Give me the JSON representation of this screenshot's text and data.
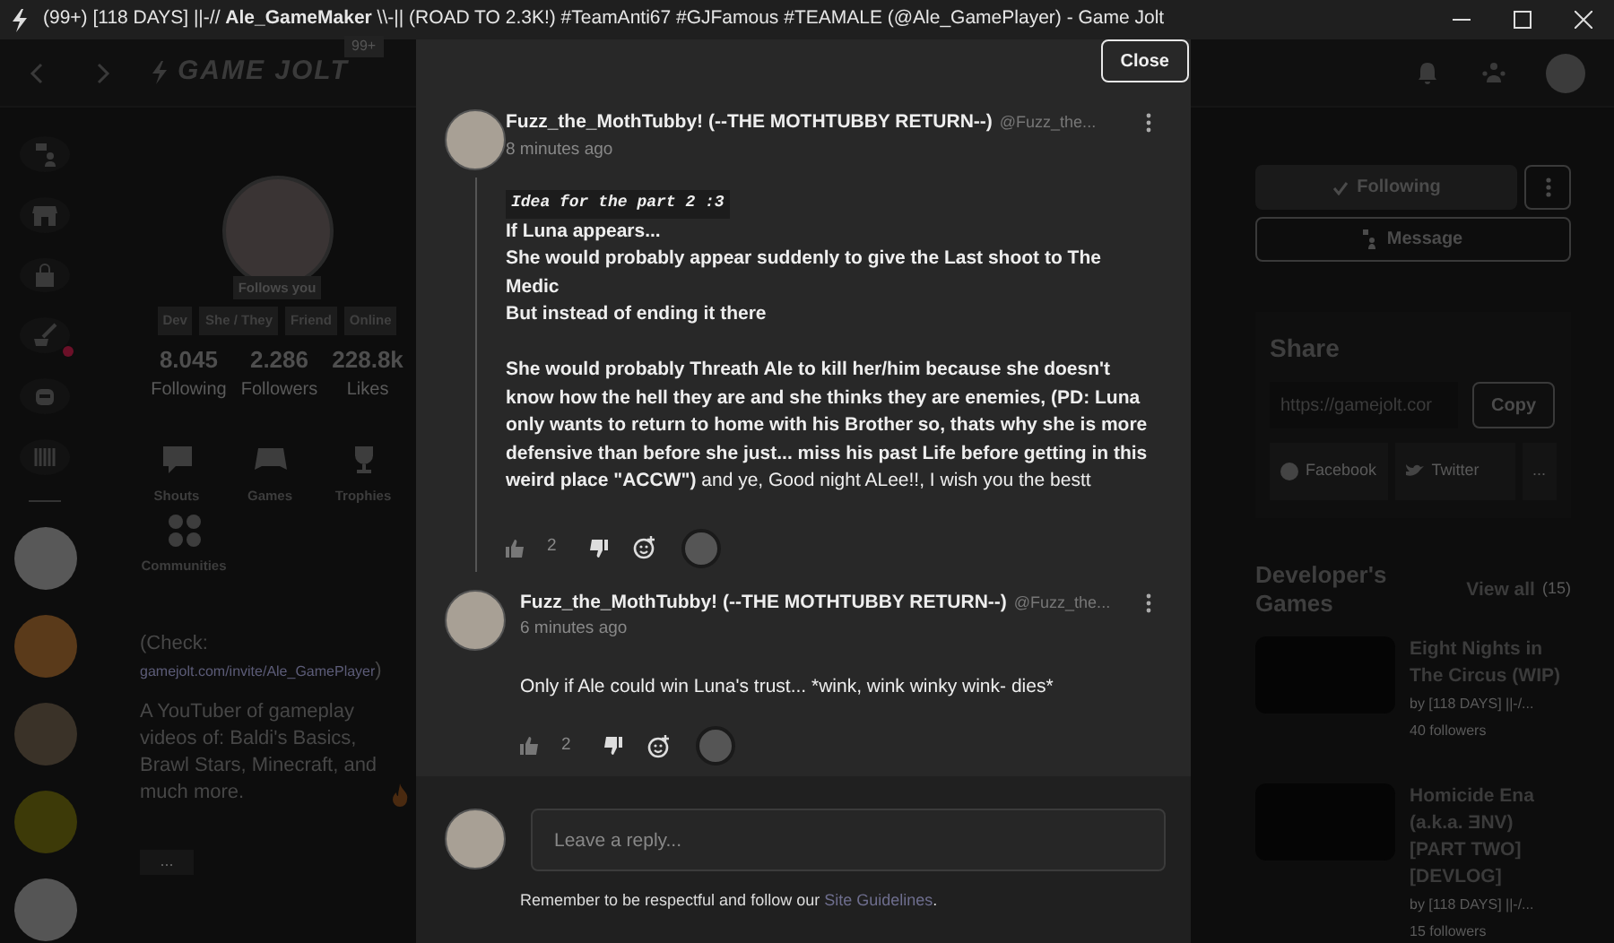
{
  "window": {
    "title": "(99+) [118 DAYS] ||-// **Ale_GameMaker** \\\\-|| (ROAD TO 2.3K!) #TeamAnti67 #GJFamous #TEAMALE (@Ale_GamePlayer) - Game Jolt"
  },
  "topbar": {
    "logo": "GAME JOLT",
    "badge": "99+"
  },
  "rail": {
    "items": [
      {
        "kind": "chat",
        "notification": false
      },
      {
        "kind": "store",
        "notification": false
      },
      {
        "kind": "bag",
        "notification": false
      },
      {
        "kind": "quill",
        "notification": true
      },
      {
        "kind": "bot",
        "notification": false
      },
      {
        "kind": "library",
        "notification": false
      }
    ]
  },
  "profile": {
    "follows_badge": "Follows you",
    "tags": [
      "Dev",
      "She / They",
      "Friend",
      "Online"
    ],
    "stats": [
      {
        "value": "8.045",
        "label": "Following"
      },
      {
        "value": "2.286",
        "label": "Followers"
      },
      {
        "value": "228.8k",
        "label": "Likes"
      }
    ],
    "nav": [
      {
        "kind": "shouts",
        "label": "Shouts"
      },
      {
        "kind": "games",
        "label": "Games"
      },
      {
        "kind": "trophies",
        "label": "Trophies"
      },
      {
        "kind": "communities",
        "label": "Communities"
      }
    ],
    "bio": {
      "check": "(Check:",
      "link": "gamejolt.com/invite/Ale_GamePlayer",
      "close": ")",
      "text": "A YouTuber of gameplay videos of: Baldi's Basics, Brawl Stars, Minecraft, and much more."
    },
    "more": "..."
  },
  "modal": {
    "close": "Close",
    "comments": [
      {
        "author": "Fuzz_the_MothTubby! (--THE MOTHTUBBY RETURN--)",
        "handle": "@Fuzz_the...",
        "time": "8 minutes ago",
        "thread": true,
        "likes": "2",
        "blocks": [
          {
            "kind": "code",
            "text": "Idea for the part 2 :3"
          },
          {
            "kind": "bold",
            "text": "If Luna appears..."
          },
          {
            "kind": "bold",
            "text": "She would probably appear suddenly to give the Last shoot to The Medic"
          },
          {
            "kind": "bold",
            "text": "But instead of ending it there"
          },
          {
            "kind": "rich",
            "text": "**She would probably Threath Ale to kill her/him because she doesn't know how the hell they are and she thinks they are enemies, (PD: Luna only wants to return to home with his Brother so, thats why she is more defensive than before she just... miss his past Life before getting in this weird place \"ACCW\")** and ye, Good night ALee!!, I wish you the bestt"
          }
        ]
      },
      {
        "author": "Fuzz_the_MothTubby! (--THE MOTHTUBBY RETURN--)",
        "handle": "@Fuzz_the...",
        "time": "6 minutes ago",
        "thread": false,
        "likes": "2",
        "blocks": [
          {
            "kind": "plain",
            "text": "Only if Ale could win Luna's trust... *wink, wink winky wink- dies*"
          }
        ]
      }
    ],
    "reply": {
      "placeholder": "Leave a reply...",
      "note": "Remember to be respectful and follow our",
      "link": "Site Guidelines",
      "note_end": "."
    }
  },
  "aside": {
    "follow": {
      "label": "Following",
      "following": true
    },
    "message": "Message",
    "share": {
      "title": "Share",
      "url": "https://gamejolt.cor",
      "copy": "Copy",
      "networks": [
        {
          "kind": "facebook",
          "label": "Facebook"
        },
        {
          "kind": "twitter",
          "label": "Twitter"
        },
        {
          "kind": "more",
          "label": "..."
        }
      ]
    },
    "games": {
      "title": "Developer's Games",
      "view_all": "View all",
      "count": "(15)",
      "items": [
        {
          "title": "Eight Nights in The Circus (WIP)",
          "by": "by [118 DAYS] ||-/...",
          "followers": "40 followers"
        },
        {
          "title": "Homicide Ena (a.k.a. ƎNV) [PART TWO] [DEVLOG]",
          "by": "by [118 DAYS] ||-/...",
          "followers": "15 followers"
        }
      ]
    }
  }
}
